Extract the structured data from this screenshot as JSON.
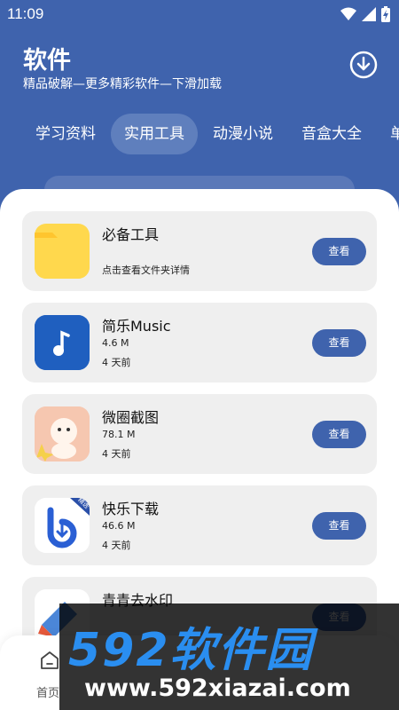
{
  "status": {
    "time": "11:09"
  },
  "header": {
    "title": "软件",
    "subtitle": "精品破解—更多精彩软件—下滑加载"
  },
  "tabs": [
    {
      "label": "学习资料",
      "active": false
    },
    {
      "label": "实用工具",
      "active": true
    },
    {
      "label": "动漫小说",
      "active": false
    },
    {
      "label": "音盒大全",
      "active": false
    },
    {
      "label": "单",
      "active": false
    }
  ],
  "cards": [
    {
      "name": "必备工具",
      "desc": "点击查看文件夹详情",
      "button": "查看",
      "icon": "folder-icon"
    },
    {
      "name": "简乐Music",
      "size": "4.6 M",
      "time": "4 天前",
      "button": "查看",
      "icon": "music-note-icon"
    },
    {
      "name": "微圈截图",
      "size": "78.1 M",
      "time": "4 天前",
      "button": "查看",
      "icon": "cartoon-app-icon"
    },
    {
      "name": "快乐下载",
      "size": "46.6 M",
      "time": "4 天前",
      "button": "查看",
      "icon": "download-app-icon",
      "badge": "精选"
    },
    {
      "name": "青青去水印",
      "button": "查看",
      "icon": "watermark-app-icon"
    }
  ],
  "bottom_nav": {
    "home_label": "首页"
  },
  "watermark": {
    "brand": "592软件园",
    "url": "www.592xiazai.com"
  },
  "colors": {
    "primary": "#3f63ad",
    "card_bg": "#efefef",
    "folder": "#ffd84d"
  }
}
